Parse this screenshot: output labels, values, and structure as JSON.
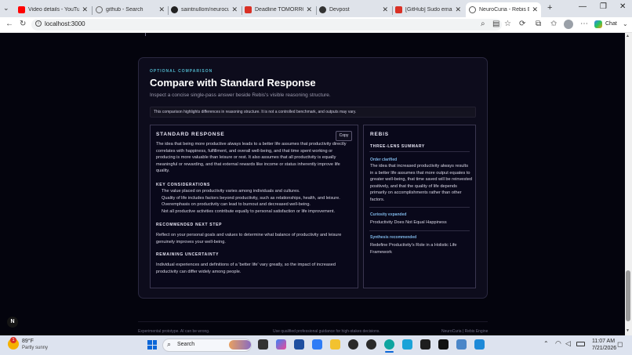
{
  "browser": {
    "tabs": [
      {
        "label": "Video details - YouTube",
        "color": "#ff0000"
      },
      {
        "label": "github - Search",
        "color": "#888888"
      },
      {
        "label": "saintnullom/neurocuria",
        "color": "#222222"
      },
      {
        "label": "Deadline TOMORROW",
        "color": "#d93025"
      },
      {
        "label": "Devpost",
        "color": "#333333"
      },
      {
        "label": "[GitHub] Sudo email ve",
        "color": "#d93025"
      },
      {
        "label": "NeuroCuria - Rebis Engine",
        "color": "#555555"
      }
    ],
    "new_tab": "+",
    "url": "localhost:3000",
    "chat_label": "Chat"
  },
  "section": {
    "eyebrow": "OPTIONAL COMPARISON",
    "title": "Compare with Standard Response",
    "subtitle": "Inspect a concise single-pass answer beside Rebis's visible reasoning structure.",
    "disclaimer": "This comparison highlights differences in reasoning structure. It is not a controlled benchmark, and outputs may vary."
  },
  "standard": {
    "heading": "STANDARD RESPONSE",
    "copy_label": "Copy",
    "paragraph": "The idea that being more productive always leads to a better life assumes that productivity directly correlates with happiness, fulfillment, and overall well-being, and that time spent working or producing is more valuable than leisure or rest. It also assumes that all productivity is equally meaningful or rewarding, and that external rewards like income or status inherently improve life quality.",
    "key_heading": "KEY CONSIDERATIONS",
    "key_items": [
      "The value placed on productivity varies among individuals and cultures.",
      "Quality of life includes factors beyond productivity, such as relationships, health, and leisure.",
      "Overemphasis on productivity can lead to burnout and decreased well-being.",
      "Not all productive activities contribute equally to personal satisfaction or life improvement."
    ],
    "next_heading": "RECOMMENDED NEXT STEP",
    "next_text": "Reflect on your personal goals and values to determine what balance of productivity and leisure genuinely improves your well-being.",
    "unc_heading": "REMAINING UNCERTAINTY",
    "unc_text": "Individual experiences and definitions of a 'better life' vary greatly, so the impact of increased productivity can differ widely among people."
  },
  "rebis": {
    "heading": "REBIS",
    "summary_heading": "THREE-LENS SUMMARY",
    "lenses": [
      {
        "label": "Order clarified",
        "text": "The idea that increased productivity always results in a better life assumes that more output equates to greater well-being, that time saved will be reinvested positively, and that the quality of life depends primarily on accomplishments rather than other factors."
      },
      {
        "label": "Curiosity expanded",
        "text": "Productivity Does Not Equal Happiness"
      },
      {
        "label": "Synthesis recommended",
        "text": "Redefine Productivity's Role in a Holistic Life Framework"
      }
    ]
  },
  "badge": "N",
  "footer": {
    "left": "Experimental prototype. AI can be wrong.",
    "center": "Use qualified professional guidance for high-stakes decisions.",
    "right": "NeuroCuria | Rebis Engine"
  },
  "taskbar": {
    "temp": "89°F",
    "weather": "Partly sunny",
    "search": "Search",
    "time": "11:07 AM",
    "date": "7/21/2026",
    "notif": "1"
  }
}
